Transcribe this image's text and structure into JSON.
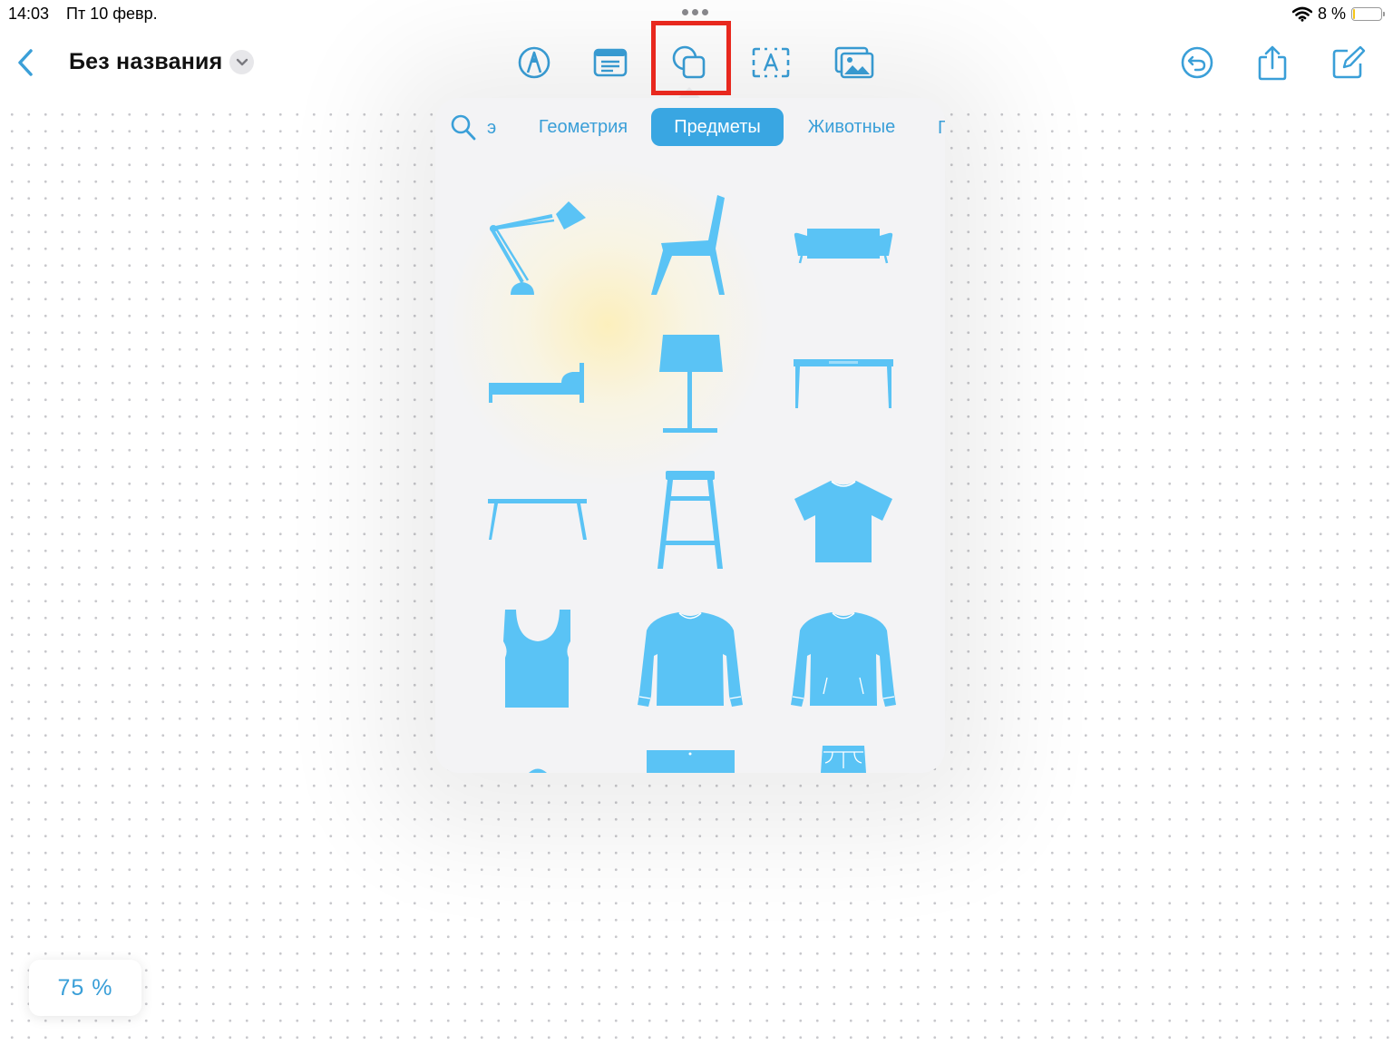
{
  "status_bar": {
    "time": "14:03",
    "date": "Пт 10 февр.",
    "battery_text": "8 %",
    "battery_level": 0.08
  },
  "toolbar": {
    "title": "Без названия",
    "accent": "#3a9fd8",
    "highlight_color": "#e8281e",
    "tools": [
      "pen-icon",
      "text-box-icon",
      "shapes-icon",
      "text-frame-icon",
      "media-icon"
    ],
    "actions": [
      "undo-icon",
      "share-icon",
      "compose-icon"
    ]
  },
  "shapes_panel": {
    "tab_cut_left": "э",
    "tabs": [
      {
        "label": "Геометрия",
        "active": false
      },
      {
        "label": "Предметы",
        "active": true
      },
      {
        "label": "Животные",
        "active": false
      }
    ],
    "tab_cut_right": "Г",
    "shape_color": "#5ac3f5",
    "items": [
      "desk-lamp",
      "chair",
      "sofa",
      "bed",
      "floor-lamp",
      "desk",
      "coffee-table",
      "bar-stool",
      "t-shirt",
      "tank-top",
      "sweater",
      "hoodie",
      "shorts",
      "jeans"
    ]
  },
  "zoom": {
    "label": "75 %"
  }
}
